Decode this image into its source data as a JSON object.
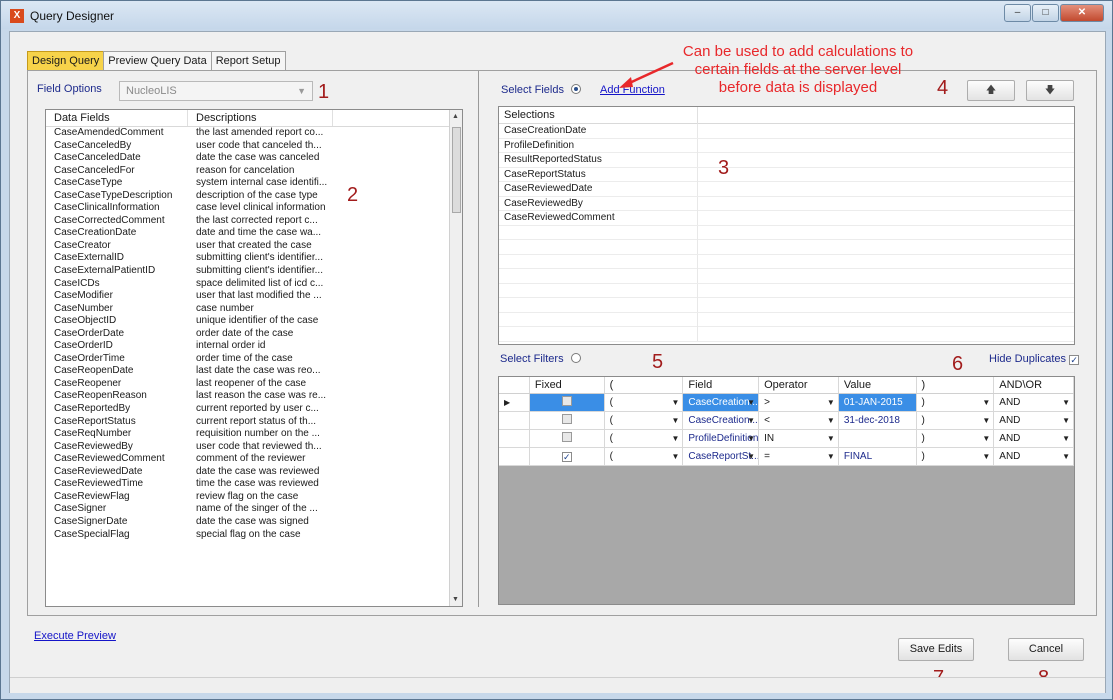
{
  "window": {
    "title": "Query Designer",
    "icon_letter": "X"
  },
  "tabs": [
    {
      "label": "Design Query",
      "active": true
    },
    {
      "label": "Preview Query Data",
      "active": false
    },
    {
      "label": "Report Setup",
      "active": false
    }
  ],
  "field_options": {
    "label": "Field Options",
    "value": "NucleoLIS"
  },
  "data_fields": {
    "headers": [
      "Data Fields",
      "Descriptions"
    ],
    "rows": [
      [
        "CaseAmendedComment",
        "the last amended report co..."
      ],
      [
        "CaseCanceledBy",
        "user code that canceled th..."
      ],
      [
        "CaseCanceledDate",
        "date the case was canceled"
      ],
      [
        "CaseCanceledFor",
        "reason for cancelation"
      ],
      [
        "CaseCaseType",
        "system internal case identifi..."
      ],
      [
        "CaseCaseTypeDescription",
        "description of the case type"
      ],
      [
        "CaseClinicalInformation",
        "case level clinical information"
      ],
      [
        "CaseCorrectedComment",
        "the last corrected report c..."
      ],
      [
        "CaseCreationDate",
        "date and time the case wa..."
      ],
      [
        "CaseCreator",
        "user that created the case"
      ],
      [
        "CaseExternalID",
        "submitting client's identifier..."
      ],
      [
        "CaseExternalPatientID",
        "submitting client's identifier..."
      ],
      [
        "CaseICDs",
        "space delimited list of icd c..."
      ],
      [
        "CaseModifier",
        "user that last modified the ..."
      ],
      [
        "CaseNumber",
        "case number"
      ],
      [
        "CaseObjectID",
        "unique identifier of the case"
      ],
      [
        "CaseOrderDate",
        "order date of the case"
      ],
      [
        "CaseOrderID",
        "internal order id"
      ],
      [
        "CaseOrderTime",
        "order time of the case"
      ],
      [
        "CaseReopenDate",
        "last date the case was reo..."
      ],
      [
        "CaseReopener",
        "last reopener of the case"
      ],
      [
        "CaseReopenReason",
        "last reason the case was re..."
      ],
      [
        "CaseReportedBy",
        "current reported by user c..."
      ],
      [
        "CaseReportStatus",
        "current report status of th..."
      ],
      [
        "CaseReqNumber",
        "requisition number on the ..."
      ],
      [
        "CaseReviewedBy",
        "user code that reviewed th..."
      ],
      [
        "CaseReviewedComment",
        "comment of the reviewer"
      ],
      [
        "CaseReviewedDate",
        "date the case was reviewed"
      ],
      [
        "CaseReviewedTime",
        "time the case was reviewed"
      ],
      [
        "CaseReviewFlag",
        "review flag on the case"
      ],
      [
        "CaseSigner",
        "name of the singer of the ..."
      ],
      [
        "CaseSignerDate",
        "date the case was signed"
      ],
      [
        "CaseSpecialFlag",
        "special flag on the case"
      ]
    ]
  },
  "select_fields": {
    "label": "Select Fields",
    "add_function": "Add Function"
  },
  "selections": {
    "header": "Selections",
    "rows": [
      "CaseCreationDate",
      "ProfileDefinition",
      "ResultReportedStatus",
      "CaseReportStatus",
      "CaseReviewedDate",
      "CaseReviewedBy",
      "CaseReviewedComment",
      "",
      "",
      "",
      "",
      "",
      "",
      "",
      ""
    ]
  },
  "select_filters": {
    "label": "Select Filters"
  },
  "hide_duplicates": {
    "label": "Hide Duplicates",
    "checked": true
  },
  "filters": {
    "headers": [
      "",
      "Fixed",
      "(",
      "Field",
      "Operator",
      "Value",
      ")",
      "AND\\OR"
    ],
    "rows": [
      {
        "fixed": false,
        "open": "(",
        "field": "CaseCreation...",
        "operator": ">",
        "value": "01-JAN-2015",
        "close": ")",
        "andor": "AND"
      },
      {
        "fixed": false,
        "open": "(",
        "field": "CaseCreation...",
        "operator": "<",
        "value": "31-dec-2018",
        "close": ")",
        "andor": "AND"
      },
      {
        "fixed": false,
        "open": "(",
        "field": "ProfileDefinition",
        "operator": "IN",
        "value": "",
        "close": ")",
        "andor": "AND"
      },
      {
        "fixed": true,
        "open": "(",
        "field": "CaseReportSt...",
        "operator": "=",
        "value": "FINAL",
        "close": ")",
        "andor": "AND"
      }
    ]
  },
  "execute_preview": "Execute Preview",
  "buttons": {
    "save": "Save Edits",
    "cancel": "Cancel"
  },
  "annotations": {
    "callout": "Can be used to add calculations to certain fields at the server level before data is displayed",
    "numbers": [
      "1",
      "2",
      "3",
      "4",
      "5",
      "6",
      "7",
      "8"
    ]
  },
  "colors": {
    "active_tab": "#f7d34a",
    "selection": "#3a8ee6",
    "annotation": "#a21c1c",
    "callout": "#e8282b"
  }
}
